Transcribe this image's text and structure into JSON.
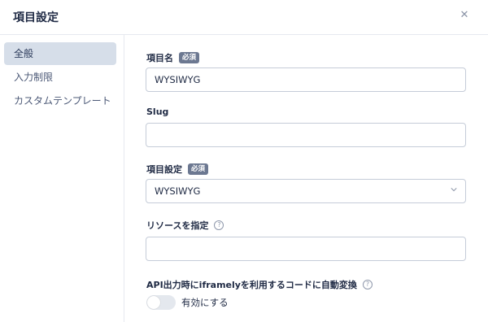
{
  "header": {
    "title": "項目設定",
    "close_icon": "close-icon"
  },
  "sidebar": {
    "items": [
      {
        "label": "全般",
        "active": true
      },
      {
        "label": "入力制限",
        "active": false
      },
      {
        "label": "カスタムテンプレート",
        "active": false
      }
    ]
  },
  "form": {
    "field_name": {
      "label": "項目名",
      "badge": "必須",
      "value": "WYSIWYG"
    },
    "slug": {
      "label": "Slug",
      "value": ""
    },
    "field_type": {
      "label": "項目設定",
      "badge": "必須",
      "selected": "WYSIWYG"
    },
    "resource": {
      "label": "リソースを指定",
      "help": "?",
      "value": ""
    },
    "iframely": {
      "label": "API出力時にiframelyを利用するコードに自動変換",
      "help": "?",
      "toggle_label": "有効にする",
      "enabled": false
    }
  },
  "colors": {
    "accent": "#6c7891",
    "active_bg": "#d6dee9",
    "border": "#c5ccd8"
  }
}
